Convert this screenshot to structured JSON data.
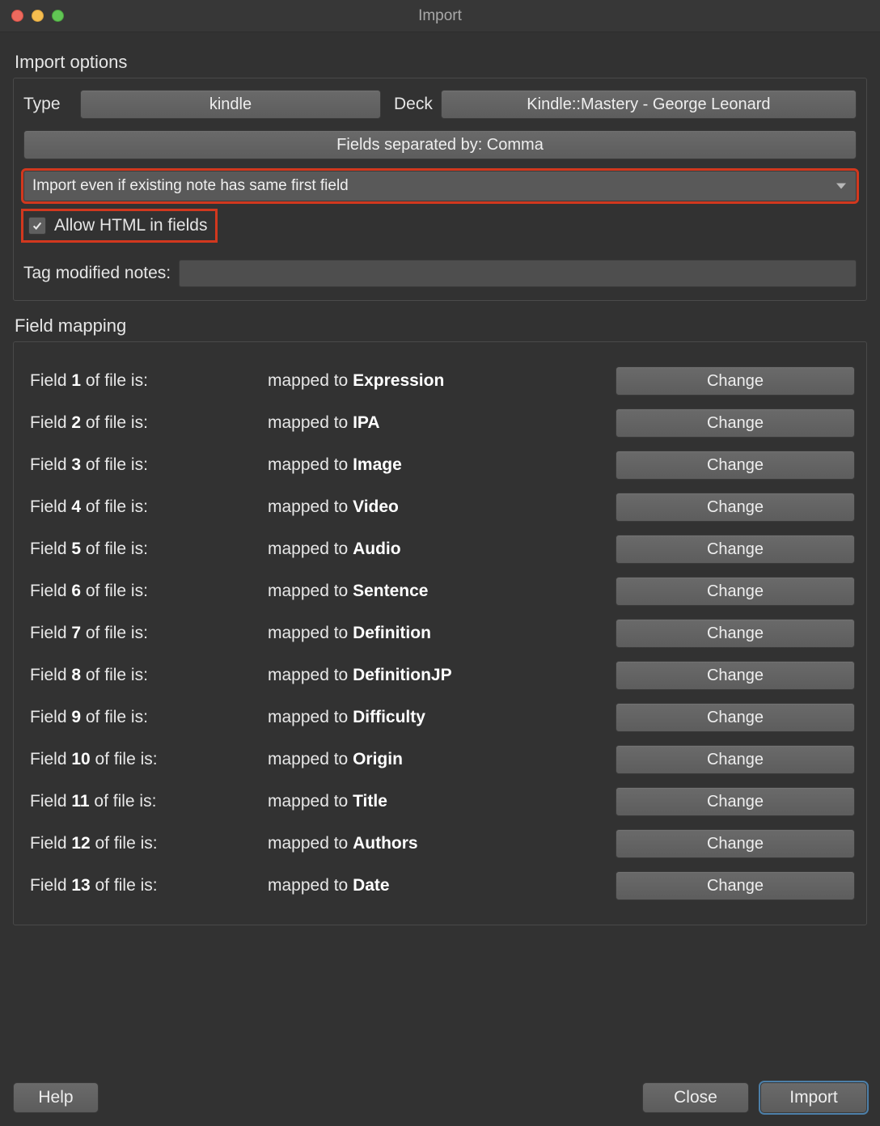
{
  "window": {
    "title": "Import"
  },
  "importOptions": {
    "sectionLabel": "Import options",
    "typeLabel": "Type",
    "typeValue": "kindle",
    "deckLabel": "Deck",
    "deckValue": "Kindle::Mastery  - George Leonard",
    "separatorButton": "Fields separated by: Comma",
    "importMode": "Import even if existing note has same first field",
    "allowHtmlLabel": "Allow HTML in fields",
    "allowHtmlChecked": true,
    "tagModifiedLabel": "Tag modified notes:",
    "tagModifiedValue": ""
  },
  "fieldMapping": {
    "sectionLabel": "Field mapping",
    "fieldPrefix": "Field",
    "fieldSuffix": "of file is:",
    "mappedPrefix": "mapped to",
    "changeLabel": "Change",
    "rows": [
      {
        "n": "1",
        "target": "Expression"
      },
      {
        "n": "2",
        "target": "IPA"
      },
      {
        "n": "3",
        "target": "Image"
      },
      {
        "n": "4",
        "target": "Video"
      },
      {
        "n": "5",
        "target": "Audio"
      },
      {
        "n": "6",
        "target": "Sentence"
      },
      {
        "n": "7",
        "target": "Definition"
      },
      {
        "n": "8",
        "target": "DefinitionJP"
      },
      {
        "n": "9",
        "target": "Difficulty"
      },
      {
        "n": "10",
        "target": "Origin"
      },
      {
        "n": "11",
        "target": "Title"
      },
      {
        "n": "12",
        "target": "Authors"
      },
      {
        "n": "13",
        "target": "Date"
      }
    ]
  },
  "footer": {
    "help": "Help",
    "close": "Close",
    "import": "Import"
  }
}
